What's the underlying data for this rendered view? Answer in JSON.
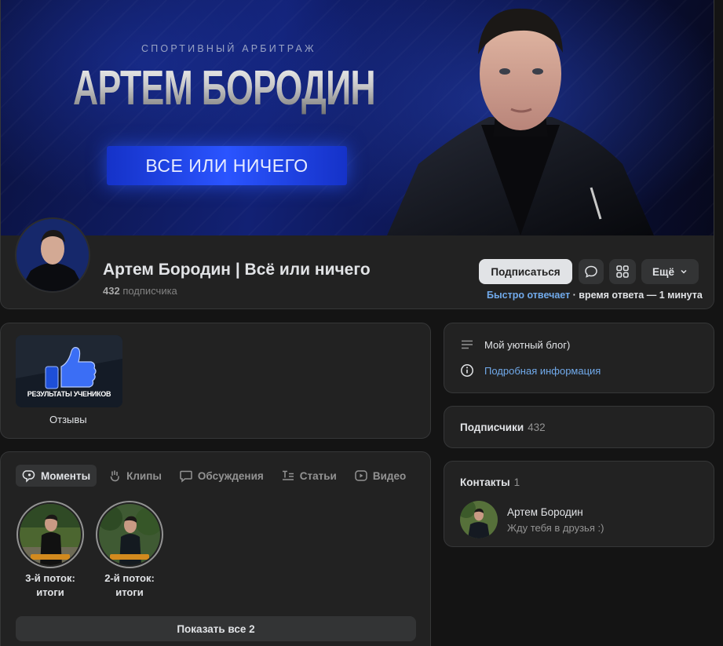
{
  "cover": {
    "subtitle": "СПОРТИВНЫЙ АРБИТРАЖ",
    "name": "АРТЕМ БОРОДИН",
    "slogan": "ВСЕ ИЛИ НИЧЕГО"
  },
  "profile": {
    "title": "Артем Бородин | Всё или ничего",
    "followers_count": "432",
    "followers_label": "подписчика"
  },
  "actions": {
    "subscribe_label": "Подписаться",
    "more_label": "Ещё",
    "reply_fast": "Быстро отвечает",
    "reply_time": " · время ответа — 1 минута"
  },
  "showcase": {
    "album_badge": "РЕЗУЛЬТАТЫ УЧЕНИКОВ",
    "album_caption": "Отзывы"
  },
  "tabs": [
    {
      "label": "Моменты",
      "icon": "moments-icon",
      "active": true
    },
    {
      "label": "Клипы",
      "icon": "clips-icon",
      "active": false
    },
    {
      "label": "Обсуждения",
      "icon": "discussions-icon",
      "active": false
    },
    {
      "label": "Статьи",
      "icon": "articles-icon",
      "active": false
    },
    {
      "label": "Видео",
      "icon": "video-icon",
      "active": false
    }
  ],
  "moments": [
    {
      "title": "3-й поток: итоги"
    },
    {
      "title": "2-й поток: итоги"
    }
  ],
  "show_all_label": "Показать все 2",
  "about": {
    "description": "Мой уютный блог)",
    "details_link": "Подробная информация"
  },
  "subscribers_block": {
    "title": "Подписчики",
    "count": "432"
  },
  "contacts_block": {
    "title": "Контакты",
    "count": "1",
    "contact_name": "Артем Бородин",
    "contact_desc": "Жду тебя в друзья :)"
  },
  "colors": {
    "background": "#141414",
    "card": "#222222",
    "accent_link": "#71aaeb",
    "cover_blue": "#2a54ff"
  }
}
